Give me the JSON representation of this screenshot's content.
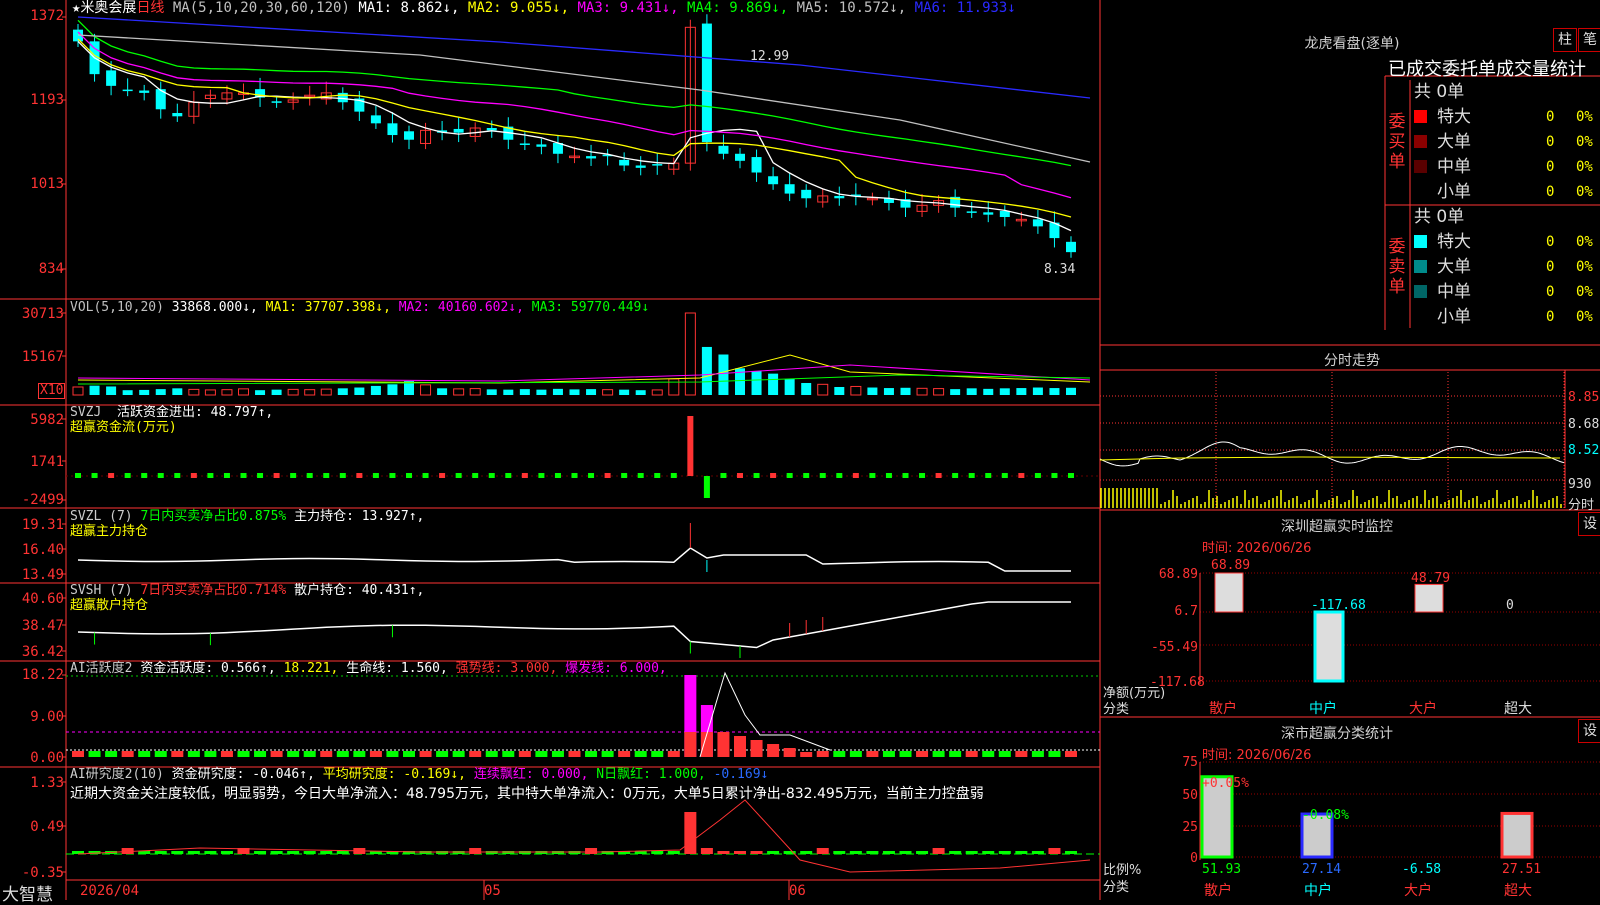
{
  "stock": {
    "star": "★",
    "name": "米奥会展",
    "period": "日线"
  },
  "ma_header": [
    {
      "text": "MA(5,10,20,30,60,120)",
      "color": "#c0c0c0"
    },
    {
      "text": "MA1: 8.862↓,",
      "color": "#ffffff"
    },
    {
      "text": "MA2: 9.055↓,",
      "color": "#ffff00"
    },
    {
      "text": "MA3: 9.431↓,",
      "color": "#ff00ff"
    },
    {
      "text": "MA4: 9.869↓,",
      "color": "#00ff00"
    },
    {
      "text": "MA5: 10.572↓,",
      "color": "#c0c0c0"
    },
    {
      "text": "MA6: 11.933↓",
      "color": "#2a2aff"
    }
  ],
  "price_axis": [
    "1372",
    "1193",
    "1013",
    "834"
  ],
  "price_marks": {
    "high": "12.99",
    "low": "8.34"
  },
  "vol_header": [
    {
      "text": "VOL(5,10,20)",
      "color": "#c0c0c0"
    },
    {
      "text": "33868.000↓,",
      "color": "#ffffff"
    },
    {
      "text": "MA1: 37707.398↓,",
      "color": "#ffff00"
    },
    {
      "text": "MA2: 40160.602↓,",
      "color": "#ff00ff"
    },
    {
      "text": "MA3: 59770.449↓",
      "color": "#00ff00"
    }
  ],
  "vol_axis": [
    "30713",
    "15167"
  ],
  "vol_unit": "X10",
  "svzj": {
    "title": "SVZJ",
    "label": "活跃资金进出: 48.797↑,",
    "sub": "超赢资金流(万元)",
    "axis": [
      "5982",
      "1741",
      "-2499"
    ]
  },
  "svzl": {
    "title": "SVZL (7)",
    "label1": "7日内买卖净占比0.875%",
    "label2": "主力持仓: 13.927↑,",
    "sub": "超赢主力持仓",
    "axis": [
      "19.31",
      "16.40",
      "13.49"
    ]
  },
  "svsh": {
    "title": "SVSH (7)",
    "label1": "7日内买卖净占比0.714%",
    "label2": "散户持仓: 40.431↑,",
    "sub": "超赢散户持仓",
    "axis": [
      "40.60",
      "38.47",
      "36.42"
    ]
  },
  "ai2": {
    "title": "AI活跃度2",
    "l1": "资金活跃度: 0.566↑,",
    "l2": "18.221,",
    "l3": "生命线: 1.560,",
    "l4": "强势线: 3.000,",
    "l5": "爆发线: 6.000,",
    "axis": [
      "18.22",
      "9.00",
      "0.00"
    ]
  },
  "ai_research": {
    "title": "AI研究度2(10)",
    "l1": "资金研究度: -0.046↑,",
    "l2": "平均研究度: -0.169↓,",
    "l3": "连续飘红: 0.000,",
    "l4": "N日飘红: 1.000,",
    "l5": "-0.169↓",
    "comment": "近期大资金关注度较低，明显弱势，今日大单净流入：48.795万元，其中特大单净流入：0万元，大单5日累计净出-832.495万元，当前主力控盘弱",
    "axis": [
      "1.33",
      "0.49",
      "-0.35"
    ]
  },
  "date_axis": {
    "brand": "大智慧",
    "d1": "2026/04",
    "d2": "05",
    "d3": "06"
  },
  "longhu": {
    "title": "龙虎看盘(逐单)",
    "btn1": "柱",
    "btn2": "笔",
    "subtitle": "已成交委托单成交量统计",
    "buy": {
      "side": "委买单",
      "total": "共 0单",
      "rows": [
        {
          "label": "特大",
          "color": "#ff0000",
          "val": "0",
          "pct": "0%"
        },
        {
          "label": "大单",
          "color": "#8b0000",
          "val": "0",
          "pct": "0%"
        },
        {
          "label": "中单",
          "color": "#5a0000",
          "val": "0",
          "pct": "0%"
        },
        {
          "label": "小单",
          "color": "#000000",
          "val": "0",
          "pct": "0%"
        }
      ]
    },
    "sell": {
      "side": "委卖单",
      "total": "共 0单",
      "rows": [
        {
          "label": "特大",
          "color": "#00ffff",
          "val": "0",
          "pct": "0%"
        },
        {
          "label": "大单",
          "color": "#008b8b",
          "val": "0",
          "pct": "0%"
        },
        {
          "label": "中单",
          "color": "#006666",
          "val": "0",
          "pct": "0%"
        },
        {
          "label": "小单",
          "color": "#000000",
          "val": "0",
          "pct": "0%"
        }
      ]
    }
  },
  "fenshi": {
    "title": "分时走势",
    "axis": [
      "8.85",
      "8.68",
      "8.52",
      "930",
      "分时"
    ]
  },
  "monitor": {
    "title": "深圳超赢实时监控",
    "btn": "设",
    "time": "时间: 2026/06/26",
    "axis": [
      "68.89",
      "6.7",
      "-55.49",
      "-117.68"
    ],
    "ylabel": "净额(万元)",
    "xlabel": "分类",
    "cats": [
      "散户",
      "中户",
      "大户",
      "超大"
    ],
    "values": [
      68.89,
      -117.68,
      48.79,
      0
    ],
    "value_labels": [
      "68.89",
      "-117.68",
      "48.79",
      "0"
    ]
  },
  "classify": {
    "title": "深市超赢分类统计",
    "btn": "设",
    "time": "时间: 2026/06/26",
    "axis": [
      "75",
      "50",
      "25",
      "0"
    ],
    "ylabel": "比例%",
    "xlabel": "分类",
    "cats": [
      "散户",
      "中户",
      "大户",
      "超大"
    ],
    "values": [
      51.93,
      27.14,
      -6.58,
      27.51
    ],
    "value_labels": [
      "51.93",
      "27.14",
      "-6.58",
      "27.51"
    ],
    "top_labels": [
      "+0.05%",
      "-0.08%"
    ]
  }
}
